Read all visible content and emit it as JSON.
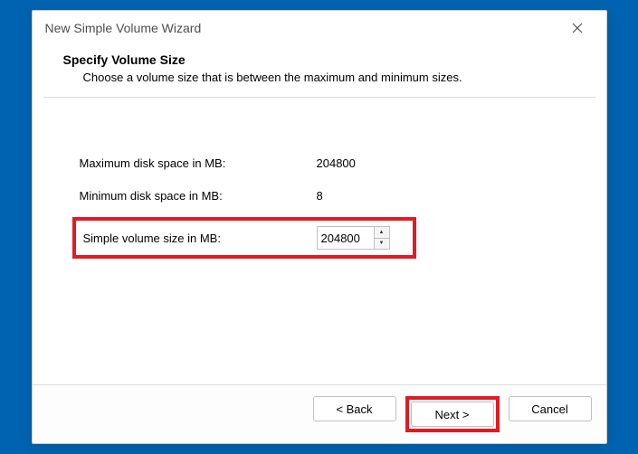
{
  "titlebar": {
    "title": "New Simple Volume Wizard"
  },
  "header": {
    "title": "Specify Volume Size",
    "subtitle": "Choose a volume size that is between the maximum and minimum sizes."
  },
  "fields": {
    "max_label": "Maximum disk space in MB:",
    "max_value": "204800",
    "min_label": "Minimum disk space in MB:",
    "min_value": "8",
    "size_label": "Simple volume size in MB:",
    "size_value": "204800"
  },
  "buttons": {
    "back": "< Back",
    "next": "Next >",
    "cancel": "Cancel"
  }
}
